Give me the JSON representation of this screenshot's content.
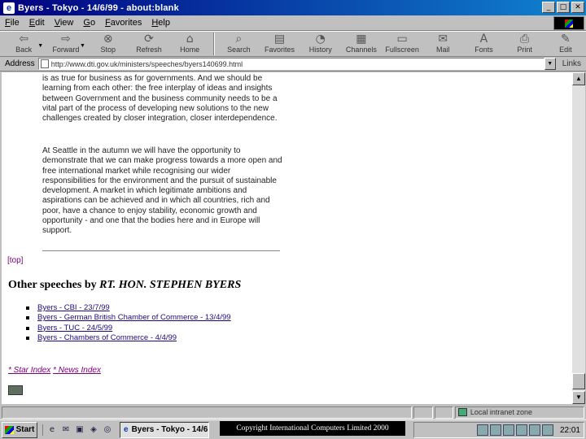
{
  "window": {
    "title": "Byers - Tokyo - 14/6/99 - about:blank",
    "controls": [
      "_",
      "□",
      "✕"
    ]
  },
  "menubar": {
    "items": [
      "File",
      "Edit",
      "View",
      "Go",
      "Favorites",
      "Help"
    ]
  },
  "toolbar": {
    "back": "Back",
    "forward": "Forward",
    "stop": "Stop",
    "refresh": "Refresh",
    "home": "Home",
    "search": "Search",
    "favorites": "Favorites",
    "history": "History",
    "channels": "Channels",
    "fullscreen": "Fullscreen",
    "mail": "Mail",
    "fonts": "Fonts",
    "print": "Print",
    "edit": "Edit"
  },
  "address": {
    "label": "Address",
    "url": "http://www.dti.gov.uk/ministers/speeches/byers140699.html",
    "links_label": "Links"
  },
  "content": {
    "para1": "is as true for business as for governments. And we should be learning from each other: the free interplay of ideas and insights between Government and the business community needs to be a vital part of the process of developing new solutions to the new challenges created by closer integration, closer interdependence.",
    "para2": "At Seattle in the autumn we will have the opportunity to demonstrate that we can make progress towards a more open and free international market while recognising our wider responsibilities for the environment and the pursuit of sustainable development. A market in which legitimate ambitions and aspirations can be achieved and in which all countries, rich and poor, have a chance to enjoy stability, economic growth and opportunity - and one that the bodies here and in Europe will support.",
    "top_link": "[top]",
    "other_heading_prefix": "Other speeches by ",
    "other_heading_speaker": "RT. HON. STEPHEN BYERS",
    "speeches": [
      "Byers - CBI - 23/7/99",
      "Byers - German British Chamber of Commerce - 13/4/99",
      "Byers - TUC - 24/5/99",
      "Byers - Chambers of Commerce - 4/4/99"
    ],
    "footer_link1": "* Star Index",
    "footer_link2": "* News Index"
  },
  "statusbar": {
    "zone": "Local intranet zone"
  },
  "taskbar": {
    "start": "Start",
    "task": "Byers - Tokyo - 14/6...",
    "clock": "22:01"
  },
  "overlay": {
    "copyright": "Copyright International Computers Limited 2000"
  }
}
